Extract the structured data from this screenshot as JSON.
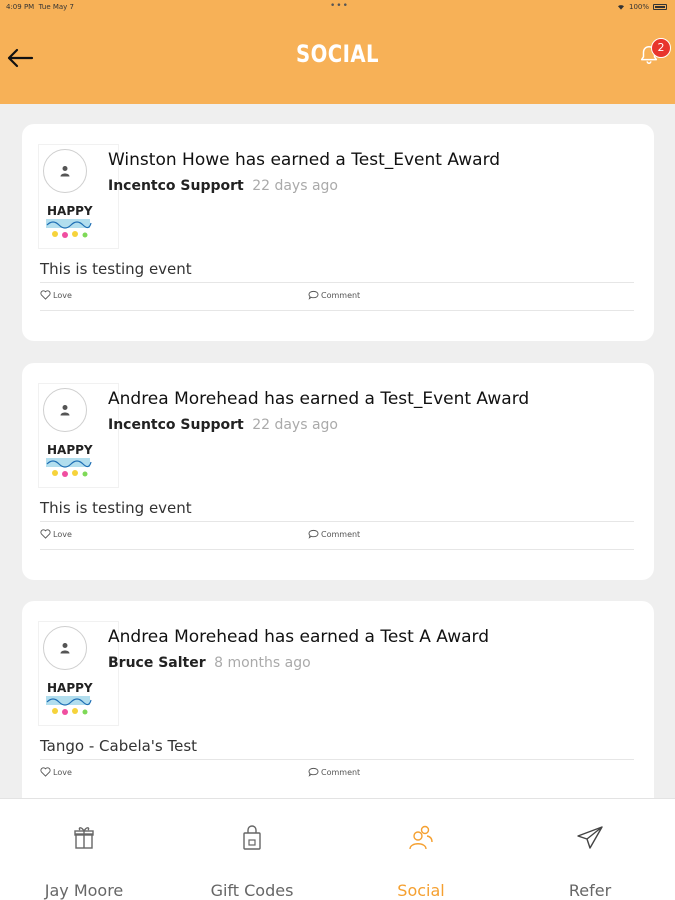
{
  "status_bar": {
    "time": "4:09 PM",
    "date": "Tue May 7",
    "dots": "•••",
    "battery": "100%"
  },
  "header": {
    "title": "SOCIAL",
    "notification_count": "2"
  },
  "colors": {
    "header_bg": "#f7b157",
    "accent": "#f5a030",
    "badge": "#e8352d"
  },
  "feed": [
    {
      "title": "Winston Howe has earned a Test_Event Award",
      "awarded_by": "Incentco Support",
      "time_ago": "22 days ago",
      "message": "This is testing event",
      "love_label": "Love",
      "comment_label": "Comment"
    },
    {
      "title": "Andrea Morehead has earned a Test_Event Award",
      "awarded_by": "Incentco Support",
      "time_ago": "22 days ago",
      "message": "This is testing event",
      "love_label": "Love",
      "comment_label": "Comment"
    },
    {
      "title": "Andrea Morehead has earned a Test A Award",
      "awarded_by": "Bruce Salter",
      "time_ago": "8 months ago",
      "message": "Tango - Cabela's Test",
      "love_label": "Love",
      "comment_label": "Comment"
    }
  ],
  "tabs": [
    {
      "label": "Jay Moore",
      "icon": "gift-icon",
      "active": false
    },
    {
      "label": "Gift Codes",
      "icon": "shopping-bag-icon",
      "active": false
    },
    {
      "label": "Social",
      "icon": "users-icon",
      "active": true
    },
    {
      "label": "Refer",
      "icon": "paper-plane-icon",
      "active": false
    }
  ]
}
